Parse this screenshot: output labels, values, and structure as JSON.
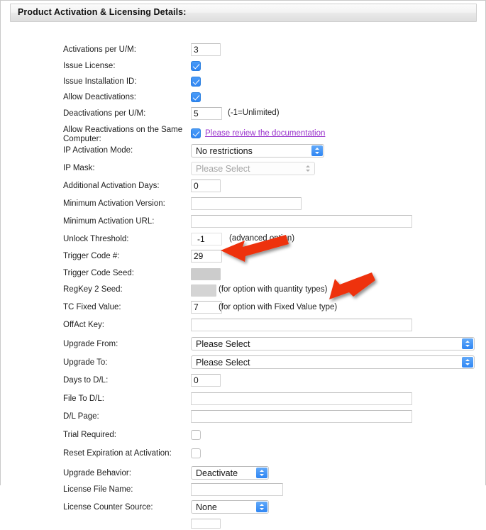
{
  "header": {
    "title": "Product Activation & Licensing Details:"
  },
  "form": {
    "rows": [
      {
        "label": "Activations per U/M:",
        "control": "text",
        "value": "3",
        "hint": ""
      },
      {
        "label": "Issue License:",
        "control": "checkbox",
        "value": "checked",
        "hint": ""
      },
      {
        "label": "Issue Installation ID:",
        "control": "checkbox",
        "value": "checked",
        "hint": ""
      },
      {
        "label": "Allow Deactivations:",
        "control": "checkbox",
        "value": "checked",
        "hint": ""
      },
      {
        "label": "Deactivations per U/M:",
        "control": "text",
        "value": "5",
        "hint": "(-1=Unlimited)"
      },
      {
        "label": "Allow Reactivations on the Same Computer:",
        "control": "checkbox-link",
        "value": "checked",
        "hint": "Please review the documentation"
      },
      {
        "label": "IP Activation Mode:",
        "control": "select",
        "value": "No restrictions",
        "hint": ""
      },
      {
        "label": "IP Mask:",
        "control": "select-disabled",
        "value": "Please Select",
        "hint": ""
      },
      {
        "label": "Additional Activation Days:",
        "control": "text",
        "value": "0",
        "hint": ""
      },
      {
        "label": "Minimum Activation Version:",
        "control": "text",
        "value": "",
        "hint": ""
      },
      {
        "label": "Minimum Activation URL:",
        "control": "text",
        "value": "",
        "hint": ""
      },
      {
        "label": "Unlock Threshold:",
        "control": "text",
        "value": "-1",
        "hint": "(advanced option)"
      },
      {
        "label": "Trigger Code #:",
        "control": "text",
        "value": "29",
        "hint": ""
      },
      {
        "label": "Trigger Code Seed:",
        "control": "text-disabled",
        "value": "",
        "hint": ""
      },
      {
        "label": "RegKey 2 Seed:",
        "control": "text-disabled",
        "value": "",
        "hint": "(for option with quantity types)"
      },
      {
        "label": "TC Fixed Value:",
        "control": "text",
        "value": "7",
        "hint": "(for option with Fixed Value type)"
      },
      {
        "label": "OffAct Key:",
        "control": "text",
        "value": "",
        "hint": ""
      },
      {
        "label": "Upgrade From:",
        "control": "select",
        "value": "Please Select",
        "hint": ""
      },
      {
        "label": "Upgrade To:",
        "control": "select",
        "value": "Please Select",
        "hint": ""
      },
      {
        "label": "Days to D/L:",
        "control": "text",
        "value": "0",
        "hint": ""
      },
      {
        "label": "File To D/L:",
        "control": "text",
        "value": "",
        "hint": ""
      },
      {
        "label": "D/L Page:",
        "control": "text",
        "value": "",
        "hint": ""
      },
      {
        "label": "Trial Required:",
        "control": "checkbox",
        "value": "unchecked",
        "hint": ""
      },
      {
        "label": "Reset Expiration at Activation:",
        "control": "checkbox",
        "value": "unchecked",
        "hint": ""
      },
      {
        "label": "Upgrade Behavior:",
        "control": "select",
        "value": "Deactivate",
        "hint": ""
      },
      {
        "label": "License File Name:",
        "control": "text",
        "value": "",
        "hint": ""
      },
      {
        "label": "License Counter Source:",
        "control": "select",
        "value": "None",
        "hint": ""
      }
    ]
  },
  "labels": {
    "activations_per_um": "Activations per U/M:",
    "issue_license": "Issue License:",
    "issue_installation_id": "Issue Installation ID:",
    "allow_deactivations": "Allow Deactivations:",
    "deactivations_per_um": "Deactivations per U/M:",
    "allow_reactivations": "Allow Reactivations on the Same Computer:",
    "ip_activation_mode": "IP Activation Mode:",
    "ip_mask": "IP Mask:",
    "additional_activation_days": "Additional Activation Days:",
    "minimum_activation_version": "Minimum Activation Version:",
    "minimum_activation_url": "Minimum Activation URL:",
    "unlock_threshold": "Unlock Threshold:",
    "trigger_code_num": "Trigger Code #:",
    "trigger_code_seed": "Trigger Code Seed:",
    "regkey2_seed": "RegKey 2 Seed:",
    "tc_fixed_value": "TC Fixed Value:",
    "offact_key": "OffAct Key:",
    "upgrade_from": "Upgrade From:",
    "upgrade_to": "Upgrade To:",
    "days_to_dl": "Days to D/L:",
    "file_to_dl": "File To D/L:",
    "dl_page": "D/L Page:",
    "trial_required": "Trial Required:",
    "reset_expiration": "Reset Expiration at Activation:",
    "upgrade_behavior": "Upgrade Behavior:",
    "license_file_name": "License File Name:",
    "license_counter_source": "License Counter Source:"
  },
  "values": {
    "activations_per_um": "3",
    "deactivations_per_um": "5",
    "ip_activation_mode": "No restrictions",
    "ip_mask": "Please Select",
    "additional_activation_days": "0",
    "minimum_activation_version": "",
    "minimum_activation_url": "",
    "unlock_threshold": "-1",
    "trigger_code_num": "29",
    "trigger_code_seed": "",
    "regkey2_seed": "",
    "tc_fixed_value": "7",
    "offact_key": "",
    "upgrade_from": "Please Select",
    "upgrade_to": "Please Select",
    "days_to_dl": "0",
    "file_to_dl": "",
    "dl_page": "",
    "upgrade_behavior": "Deactivate",
    "license_file_name": "",
    "license_counter_source": "None"
  },
  "hints": {
    "deactivations_unlimited": "(-1=Unlimited)",
    "unlock_threshold": "(advanced option)",
    "regkey2_seed": "(for option with quantity types)",
    "tc_fixed_value": "(for option with Fixed Value type)"
  },
  "link": {
    "documentation": "Please review the documentation"
  },
  "annotations": {
    "arrows": [
      {
        "name": "arrow-trigger-code",
        "points_to": "Trigger Code #: 29"
      },
      {
        "name": "arrow-tc-fixed-value",
        "points_to": "TC Fixed Value: 7"
      }
    ]
  },
  "colors": {
    "accent_blue": "#2f86f3",
    "link_purple": "#9933cc",
    "annotation_red": "#ee3311",
    "header_bar": "#eeeeee",
    "disabled_field": "#cccccc"
  }
}
